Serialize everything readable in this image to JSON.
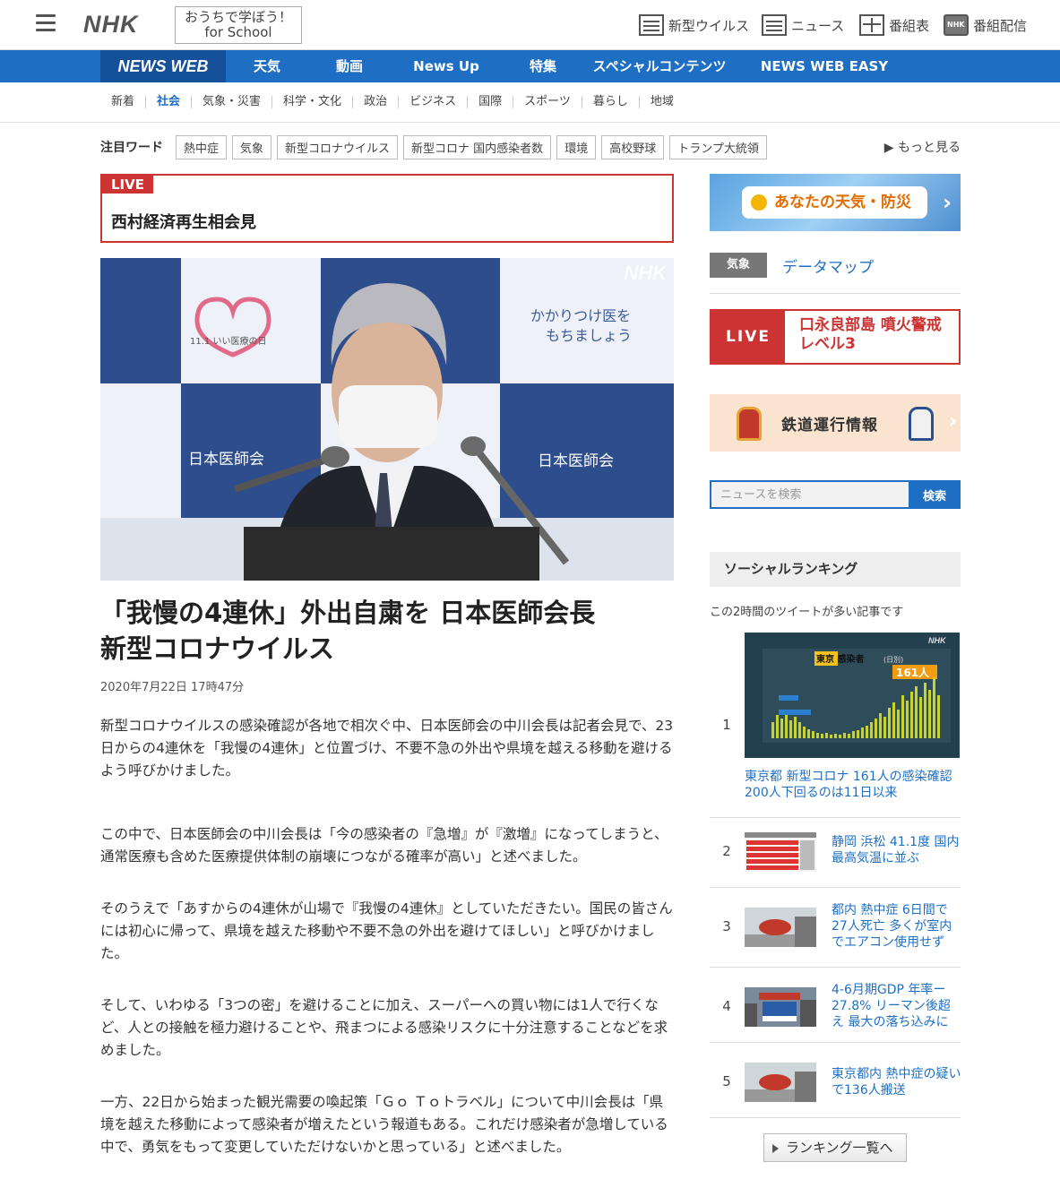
{
  "header": {
    "logo": "NHK",
    "school_line1": "おうちで学ぼう！",
    "school_line2": "for School",
    "links": [
      "新型ウイルス",
      "ニュース",
      "番組表",
      "番組配信"
    ]
  },
  "bluenav": {
    "brand": "NEWS WEB",
    "items": [
      "天気",
      "動画",
      "News Up",
      "特集",
      "スペシャルコンテンツ",
      "NEWS WEB EASY"
    ]
  },
  "catnav": {
    "items": [
      "新着",
      "社会",
      "気象・災害",
      "科学・文化",
      "政治",
      "ビジネス",
      "国際",
      "スポーツ",
      "暮らし",
      "地域"
    ],
    "active": "社会"
  },
  "attention": {
    "label": "注目ワード",
    "tags": [
      "熱中症",
      "気象",
      "新型コロナウイルス",
      "新型コロナ 国内感染者数",
      "環境",
      "高校野球",
      "トランプ大統領"
    ],
    "more": "▶ もっと見る"
  },
  "live": {
    "tag": "LIVE",
    "title": "西村経済再生相会見"
  },
  "hero": {
    "watermark": "NHK",
    "text_left": "11.1 いい医療の日",
    "text_right_line1": "かかりつけ医を",
    "text_right_line2": "もちましょう",
    "org": "日本医師会"
  },
  "article": {
    "headline_line1": "「我慢の4連休」外出自粛を 日本医師会長",
    "headline_line2": "新型コロナウイルス",
    "date": "2020年7月22日 17時47分",
    "paragraphs": [
      "新型コロナウイルスの感染確認が各地で相次ぐ中、日本医師会の中川会長は記者会見で、23日からの4連休を「我慢の4連休」と位置づけ、不要不急の外出や県境を越える移動を避けるよう呼びかけました。",
      "この中で、日本医師会の中川会長は「今の感染者の『急増』が『激増』になってしまうと、通常医療も含めた医療提供体制の崩壊につながる確率が高い」と述べました。",
      "そのうえで「あすからの4連休が山場で『我慢の4連休』としていただきたい。国民の皆さんには初心に帰って、県境を越えた移動や不要不急の外出を避けてほしい」と呼びかけました。",
      "そして、いわゆる「3つの密」を避けることに加え、スーパーへの買い物には1人で行くなど、人との接触を極力避けることや、飛まつによる感染リスクに十分注意することなどを求めました。",
      "一方、22日から始まった観光需要の喚起策「Ｇｏ Ｔｏトラベル」について中川会長は「県境を越えた移動によって感染者が増えたという報道もある。これだけ感染者が急増している中で、勇気をもって変更していただけないかと思っている」と述べました。"
    ]
  },
  "sidebar": {
    "weather": "あなたの天気・防災",
    "kisho_badge": "気象",
    "kisho_link": "データマップ",
    "live_tag": "LIVE",
    "live_title": "口永良部島 噴火警戒レベル3",
    "rail": "鉄道運行情報",
    "search_placeholder": "ニュースを検索",
    "search_button": "検索",
    "ranking_title": "ソーシャルランキング",
    "ranking_sub": "この2時間のツイートが多い記事です",
    "ranking_chart_title": "東京 感染者",
    "ranking_chart_sub": "(日別)",
    "ranking_chart_value": "161人",
    "ranking_chart_logo": "NHK",
    "rankings": [
      {
        "rank": "1",
        "title": "東京都 新型コロナ 161人の感染確認 200人下回るのは11日以来"
      },
      {
        "rank": "2",
        "title": "静岡 浜松 41.1度 国内最高気温に並ぶ"
      },
      {
        "rank": "3",
        "title": "都内 熱中症 6日間で27人死亡 多くが室内でエアコン使用せず"
      },
      {
        "rank": "4",
        "title": "4-6月期GDP 年率ー27.8% リーマン後超え 最大の落ち込みに"
      },
      {
        "rank": "5",
        "title": "東京都内 熱中症の疑いで136人搬送"
      }
    ],
    "ranking_more": "ランキング一覧へ"
  },
  "colors": {
    "brand_blue": "#1e6fc4",
    "live_red": "#cc3333"
  }
}
